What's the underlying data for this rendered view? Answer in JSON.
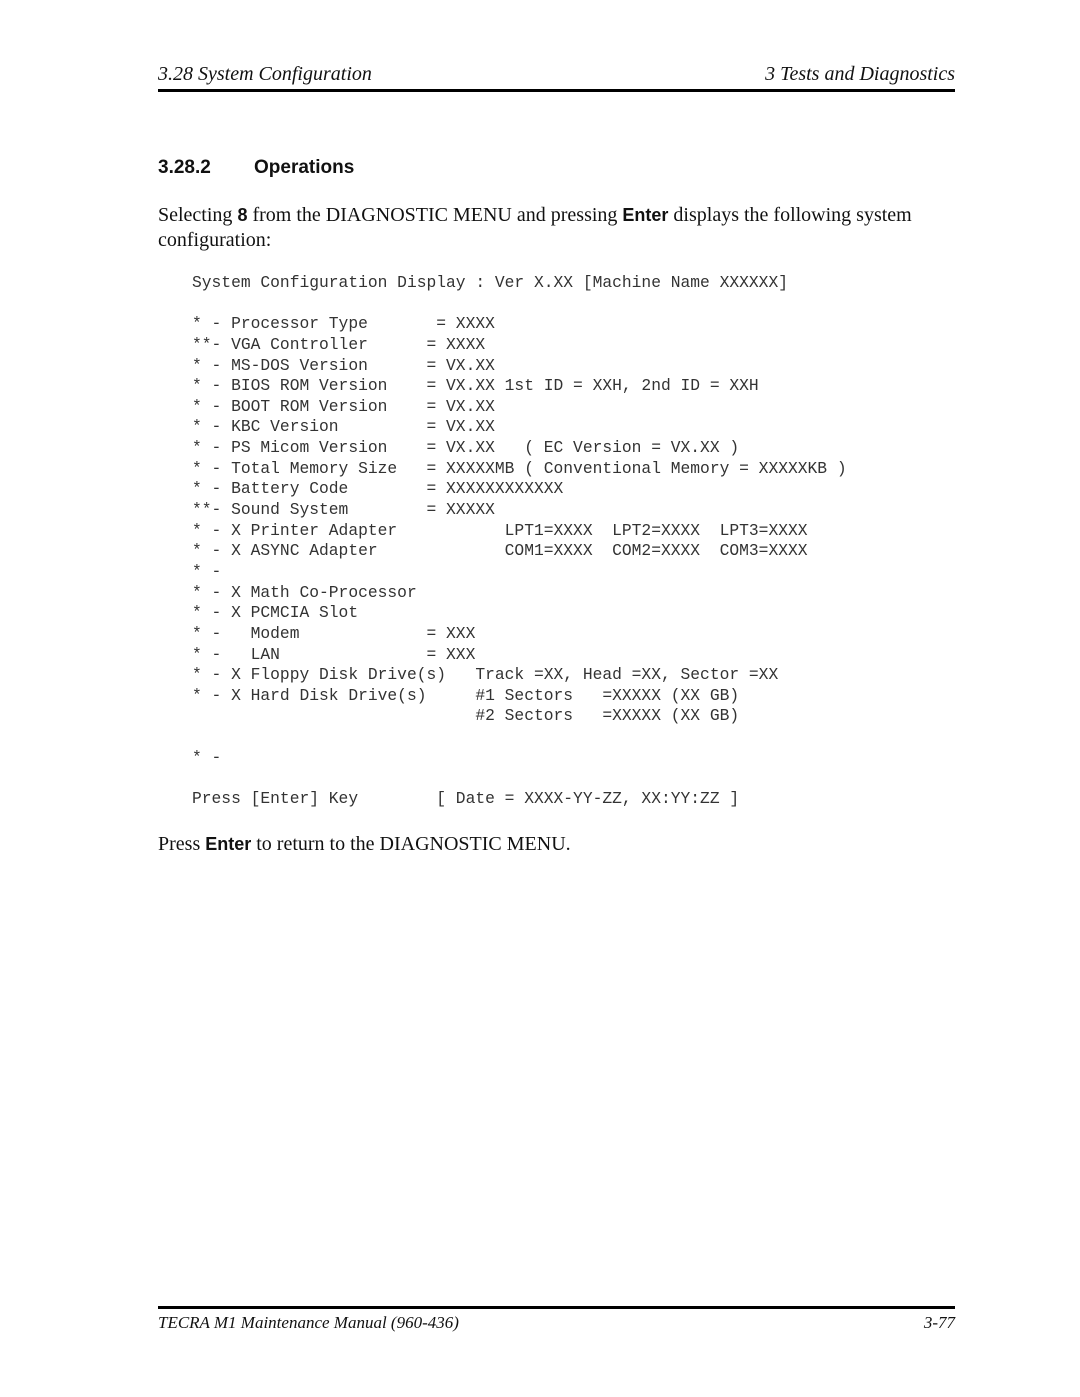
{
  "header": {
    "section": "3.28  System Configuration",
    "chapter": "3  Tests and Diagnostics"
  },
  "section_heading": {
    "number": "3.28.2",
    "title": "Operations"
  },
  "intro": {
    "part1": "Selecting ",
    "key1": "8",
    "part2": " from the DIAGNOSTIC MENU and pressing ",
    "key2": "Enter",
    "part3": " displays the following system configuration:"
  },
  "screen_lines": [
    "System Configuration Display : Ver X.XX [Machine Name XXXXXX]",
    "",
    "* - Processor Type       = XXXX",
    "**- VGA Controller      = XXXX",
    "* - MS-DOS Version      = VX.XX",
    "* - BIOS ROM Version    = VX.XX 1st ID = XXH, 2nd ID = XXH",
    "* - BOOT ROM Version    = VX.XX",
    "* - KBC Version         = VX.XX",
    "* - PS Micom Version    = VX.XX   ( EC Version = VX.XX )",
    "* - Total Memory Size   = XXXXXMB ( Conventional Memory = XXXXXKB )",
    "* - Battery Code        = XXXXXXXXXXXX",
    "**- Sound System        = XXXXX",
    "* - X Printer Adapter           LPT1=XXXX  LPT2=XXXX  LPT3=XXXX",
    "* - X ASYNC Adapter             COM1=XXXX  COM2=XXXX  COM3=XXXX",
    "* -",
    "* - X Math Co-Processor",
    "* - X PCMCIA Slot",
    "* -   Modem             = XXX",
    "* -   LAN               = XXX",
    "* - X Floppy Disk Drive(s)   Track =XX, Head =XX, Sector =XX",
    "* - X Hard Disk Drive(s)     #1 Sectors   =XXXXX (XX GB)",
    "                             #2 Sectors   =XXXXX (XX GB)",
    "",
    "* -",
    "",
    "Press [Enter] Key        [ Date = XXXX-YY-ZZ, XX:YY:ZZ ]"
  ],
  "outro": {
    "part1": "Press ",
    "key": "Enter",
    "part2": " to return to the DIAGNOSTIC MENU."
  },
  "footer": {
    "manual": "TECRA M1  Maintenance Manual (960-436)",
    "page": "3-77"
  }
}
